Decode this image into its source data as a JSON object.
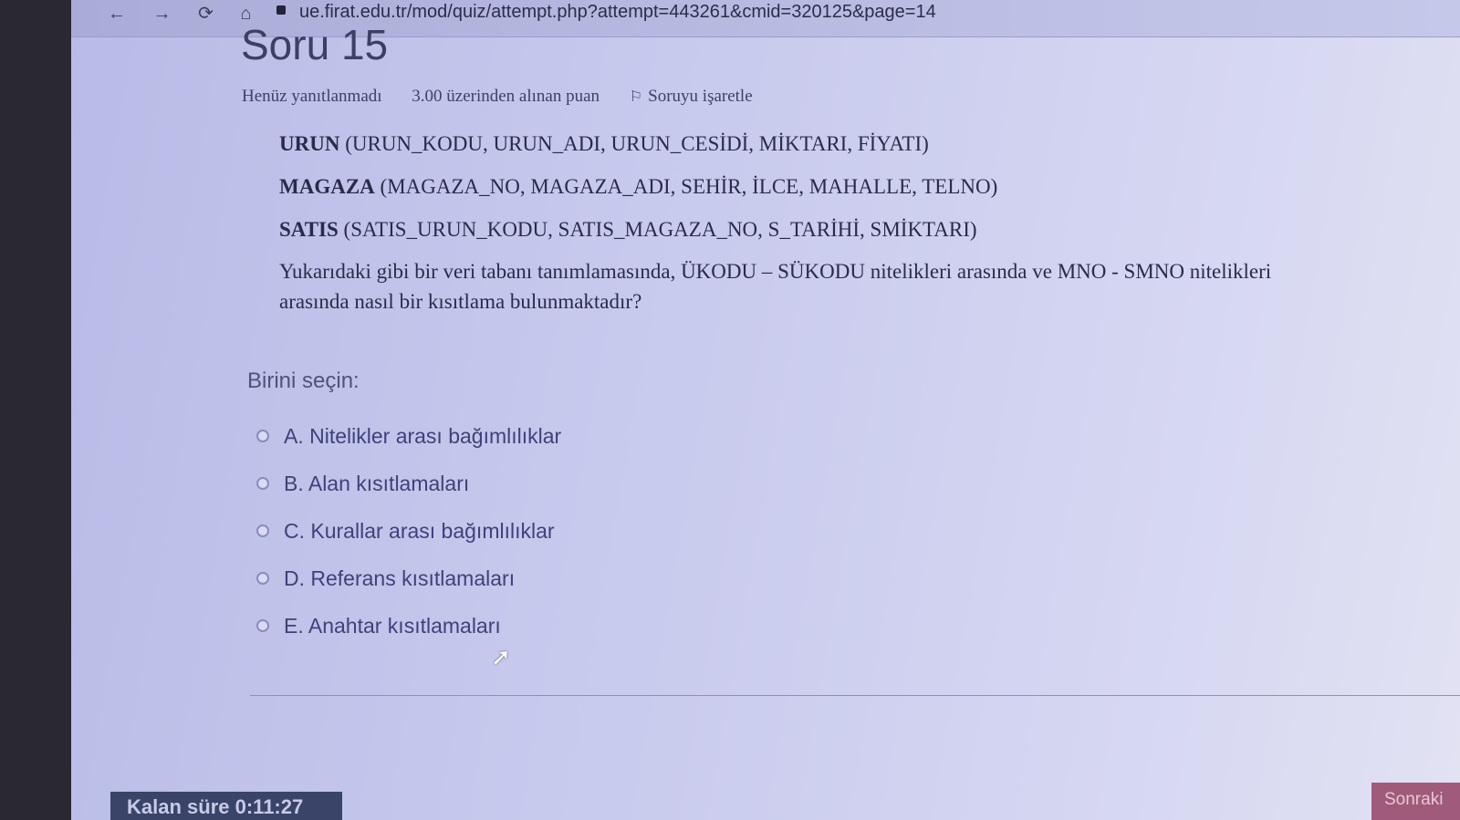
{
  "browser": {
    "url": "ue.firat.edu.tr/mod/quiz/attempt.php?attempt=443261&cmid=320125&page=14",
    "nav_glyphs": "← → ⟳ ⌂"
  },
  "question": {
    "title": "Soru 15",
    "status": "Henüz yanıtlanmadı",
    "points": "3.00 üzerinden alınan puan",
    "flag_label": "Soruyu işaretle",
    "schema": [
      {
        "name": "URUN",
        "fields": "(URUN_KODU, URUN_ADI, URUN_CESİDİ, MİKTARI, FİYATI)"
      },
      {
        "name": "MAGAZA",
        "fields": "(MAGAZA_NO, MAGAZA_ADI, SEHİR, İLCE, MAHALLE, TELNO)"
      },
      {
        "name": "SATIS",
        "fields": "(SATIS_URUN_KODU,  SATIS_MAGAZA_NO, S_TARİHİ, SMİKTARI)"
      }
    ],
    "text": "Yukarıdaki gibi bir veri tabanı tanımlamasında, ÜKODU – SÜKODU nitelikleri arasında ve MNO - SMNO nitelikleri arasında nasıl bir kısıtlama bulunmaktadır?",
    "answer_prompt": "Birini seçin:",
    "options": [
      "A. Nitelikler arası bağımlılıklar",
      "B. Alan kısıtlamaları",
      "C. Kurallar arası bağımlılıklar",
      "D. Referans kısıtlamaları",
      "E. Anahtar kısıtlamaları"
    ]
  },
  "footer": {
    "timer": "Kalan süre 0:11:27",
    "next_label": "Sonraki"
  }
}
